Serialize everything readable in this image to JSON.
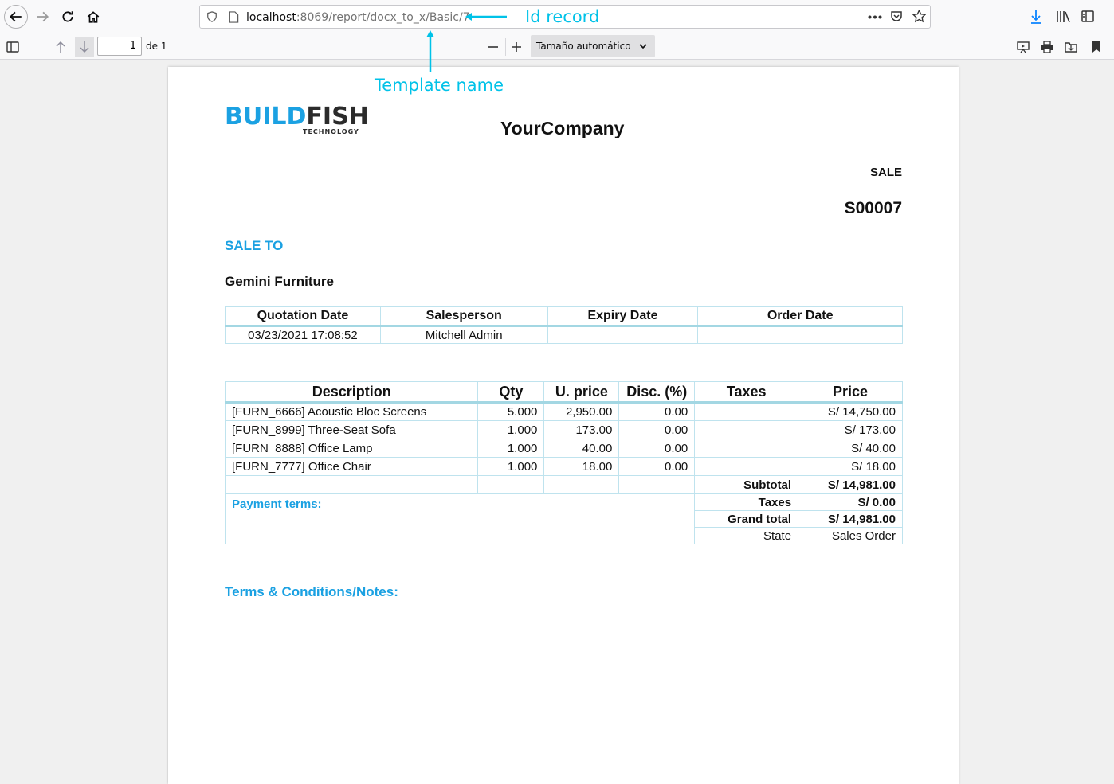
{
  "browser": {
    "url_host": "localhost",
    "url_path": ":8069/report/docx_to_x/Basic/7"
  },
  "pdf_toolbar": {
    "page_number": "1",
    "page_count_label": "de 1",
    "zoom_label": "Tamaño automático"
  },
  "annotations": {
    "id_record": "Id record",
    "template_name": "Template name"
  },
  "logo": {
    "main_build": "BUILD",
    "main_fish": "FISH",
    "sub": "TECHNOLOGY"
  },
  "report": {
    "company": "YourCompany",
    "doc_type": "SALE",
    "doc_number": "S00007",
    "sale_to_label": "SALE TO",
    "partner": "Gemini Furniture",
    "info_headers": [
      "Quotation Date",
      "Salesperson",
      "Expiry Date",
      "Order Date"
    ],
    "info_values": [
      "03/23/2021 17:08:52",
      "Mitchell Admin",
      "",
      ""
    ],
    "line_headers": [
      "Description",
      "Qty",
      "U. price",
      "Disc. (%)",
      "Taxes",
      "Price"
    ],
    "lines": [
      {
        "desc": "[FURN_6666] Acoustic Bloc Screens",
        "qty": "5.000",
        "price_unit": "2,950.00",
        "disc": "0.00",
        "taxes": "",
        "subtotal": "S/ 14,750.00"
      },
      {
        "desc": "[FURN_8999] Three-Seat Sofa",
        "qty": "1.000",
        "price_unit": "173.00",
        "disc": "0.00",
        "taxes": "",
        "subtotal": "S/ 173.00"
      },
      {
        "desc": "[FURN_8888] Office Lamp",
        "qty": "1.000",
        "price_unit": "40.00",
        "disc": "0.00",
        "taxes": "",
        "subtotal": "S/ 40.00"
      },
      {
        "desc": "[FURN_7777] Office Chair",
        "qty": "1.000",
        "price_unit": "18.00",
        "disc": "0.00",
        "taxes": "",
        "subtotal": "S/ 18.00"
      }
    ],
    "subtotal_label": "Subtotal",
    "subtotal_value": "S/ 14,981.00",
    "payment_terms_label": "Payment terms:",
    "taxes_label": "Taxes",
    "taxes_value": "S/ 0.00",
    "grand_total_label": "Grand total",
    "grand_total_value": "S/ 14,981.00",
    "state_label": "State",
    "state_value": "Sales Order",
    "terms_label": "Terms & Conditions/Notes:"
  },
  "colors": {
    "accent": "#1ba1e2",
    "annotation": "#00c2e8",
    "table_border": "#bfe3ee"
  }
}
